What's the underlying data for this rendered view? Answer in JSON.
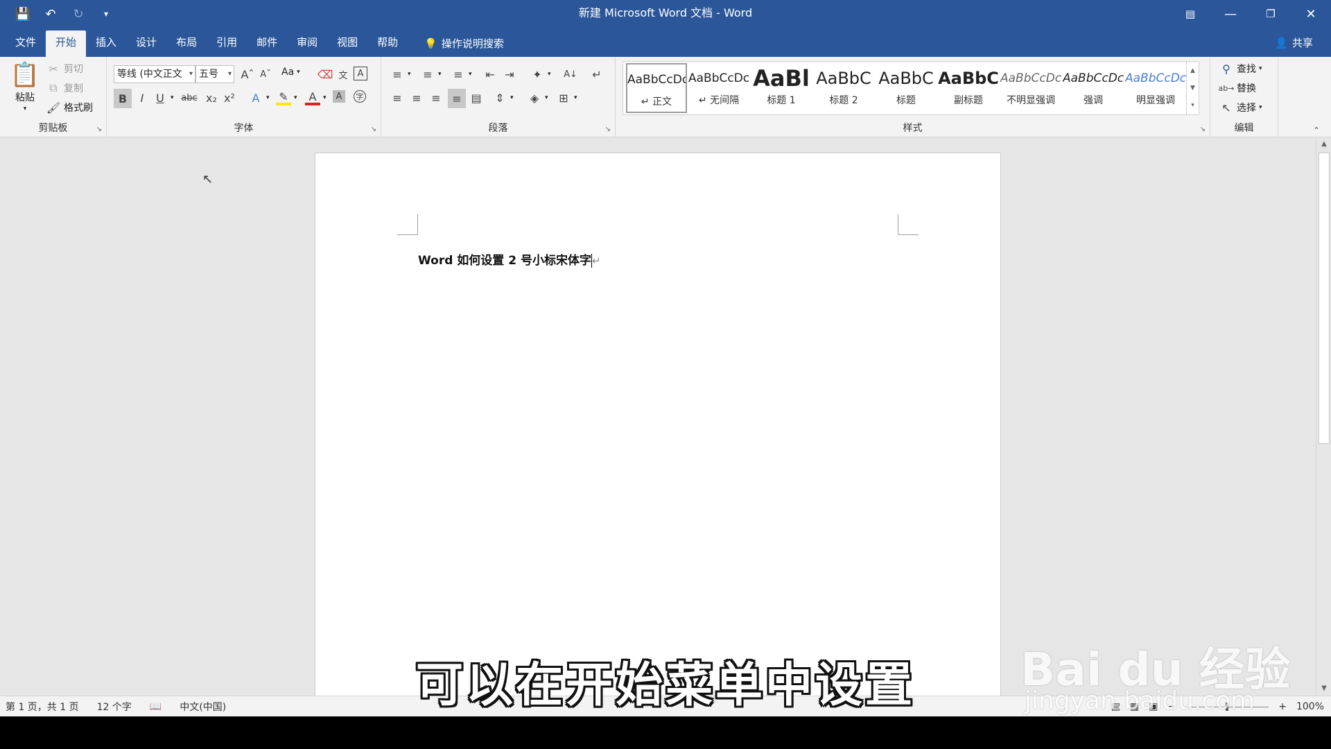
{
  "titlebar": {
    "title": "新建 Microsoft Word 文档  -  Word",
    "qat_icons": [
      "save-icon",
      "undo-icon",
      "redo-icon",
      "customize-qat-icon"
    ],
    "window_icons": [
      "ribbon-display-icon",
      "minimize-icon",
      "restore-icon",
      "close-icon"
    ]
  },
  "tabs": [
    {
      "label": "文件",
      "active": false
    },
    {
      "label": "开始",
      "active": true
    },
    {
      "label": "插入",
      "active": false
    },
    {
      "label": "设计",
      "active": false
    },
    {
      "label": "布局",
      "active": false
    },
    {
      "label": "引用",
      "active": false
    },
    {
      "label": "邮件",
      "active": false
    },
    {
      "label": "审阅",
      "active": false
    },
    {
      "label": "视图",
      "active": false
    },
    {
      "label": "帮助",
      "active": false
    }
  ],
  "tell_me": "操作说明搜索",
  "share": "共享",
  "clipboard": {
    "paste": "粘贴",
    "cut": "剪切",
    "copy": "复制",
    "format_painter": "格式刷",
    "label": "剪贴板"
  },
  "font": {
    "family": "等线 (中文正文",
    "size": "五号",
    "label": "字体",
    "change_case": "Aa"
  },
  "paragraph": {
    "label": "段落"
  },
  "styles": {
    "label": "样式",
    "items": [
      {
        "preview": "AaBbCcDc",
        "name": "↵ 正文",
        "selected": true
      },
      {
        "preview": "AaBbCcDc",
        "name": "↵ 无间隔",
        "selected": false
      },
      {
        "preview": "AaBl",
        "name": "标题 1",
        "selected": false
      },
      {
        "preview": "AaBbC",
        "name": "标题 2",
        "selected": false
      },
      {
        "preview": "AaBbC",
        "name": "标题",
        "selected": false
      },
      {
        "preview": "AaBbC",
        "name": "副标题",
        "selected": false
      },
      {
        "preview": "AaBbCcDc",
        "name": "不明显强调",
        "selected": false
      },
      {
        "preview": "AaBbCcDc",
        "name": "强调",
        "selected": false
      },
      {
        "preview": "AaBbCcDc",
        "name": "明显强调",
        "selected": false
      }
    ]
  },
  "editing": {
    "find": "查找",
    "replace": "替换",
    "select": "选择",
    "label": "编辑"
  },
  "document": {
    "text": "Word 如何设置 2 号小标宋体字"
  },
  "statusbar": {
    "page": "第 1 页，共 1 页",
    "words": "12 个字",
    "language": "中文(中国)",
    "zoom": "100%"
  },
  "overlay": {
    "subtitle": "可以在开始菜单中设置",
    "watermark_main": "Bai du 经验",
    "watermark_sub": "jingyan.baidu.com"
  },
  "colors": {
    "brand_blue": "#2b579a",
    "ribbon_bg": "#f3f3f3",
    "doc_bg": "#e6e6e6",
    "font_color_red": "#e02020",
    "highlight_yellow": "#ffe600"
  }
}
